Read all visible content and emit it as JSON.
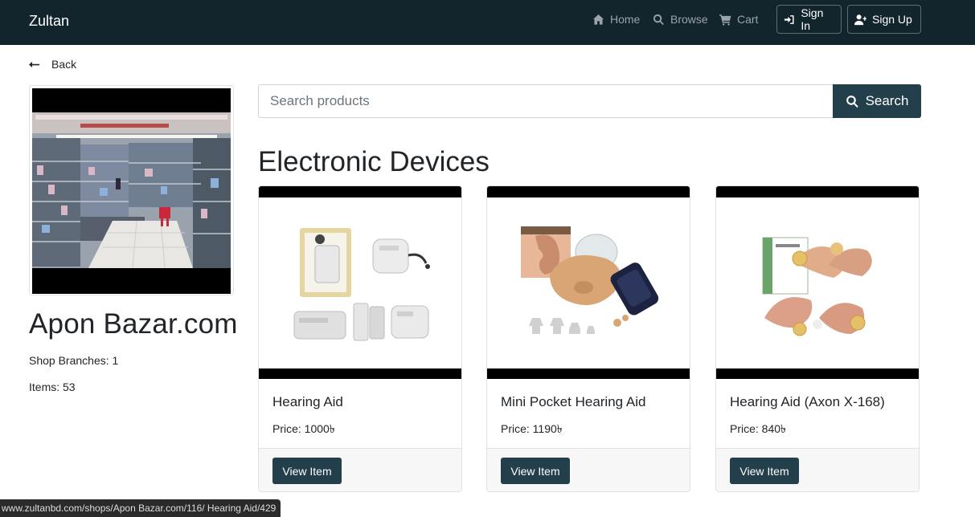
{
  "nav": {
    "brand": "Zultan",
    "home": "Home",
    "browse": "Browse",
    "cart": "Cart",
    "sign_in": "Sign In",
    "sign_up": "Sign Up"
  },
  "back_label": "Back",
  "shop": {
    "name": "Apon Bazar.com",
    "branches": "Shop Branches: 1",
    "items": "Items: 53"
  },
  "search": {
    "placeholder": "Search products",
    "button": "Search"
  },
  "category": "Electronic Devices",
  "products": [
    {
      "title": "Hearing Aid",
      "price": "Price: 1000৳",
      "button": "View Item"
    },
    {
      "title": "Mini Pocket Hearing Aid",
      "price": "Price: 1190৳",
      "button": "View Item"
    },
    {
      "title": "Hearing Aid (Axon X-168)",
      "price": "Price: 840৳",
      "button": "View Item"
    }
  ],
  "status_url": "www.zultanbd.com/shops/Apon Bazar.com/116/ Hearing Aid/429",
  "colors": {
    "navbar": "#12242c",
    "primary_button": "#233f4b"
  }
}
